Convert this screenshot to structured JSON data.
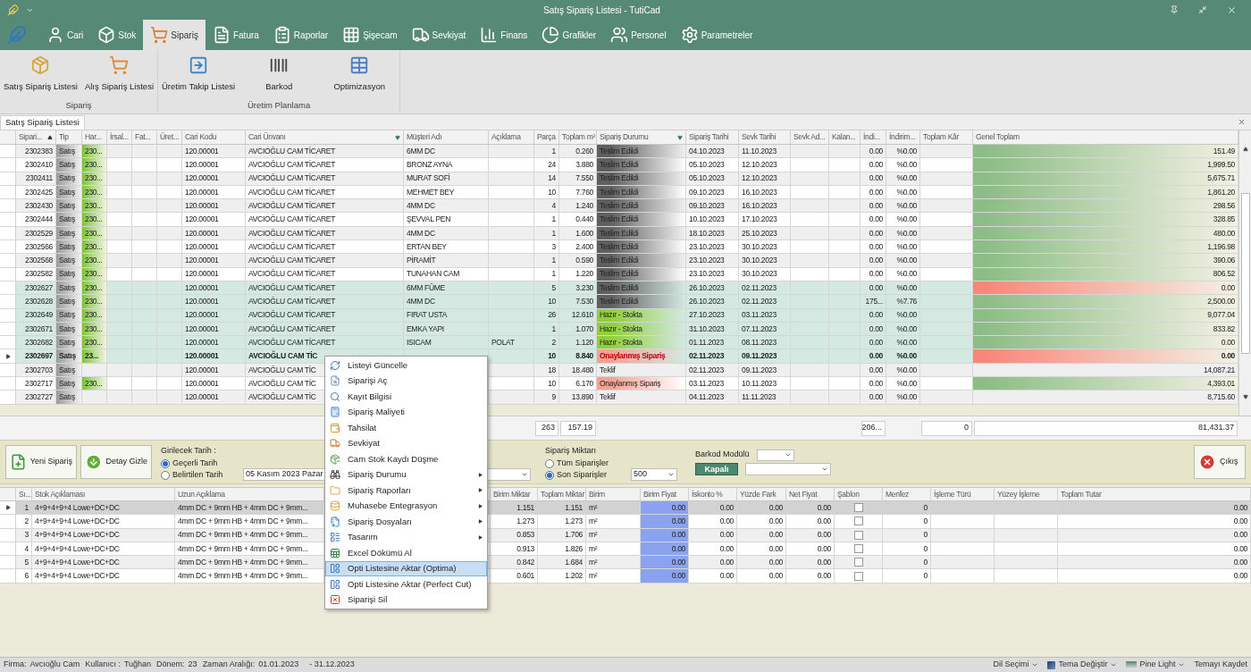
{
  "window": {
    "title": "Satış Sipariş Listesi - TutiCad"
  },
  "ribbon_tabs": [
    {
      "label": "Cari",
      "selected": false
    },
    {
      "label": "Stok",
      "selected": false
    },
    {
      "label": "Sipariş",
      "selected": true
    },
    {
      "label": "Fatura",
      "selected": false
    },
    {
      "label": "Raporlar",
      "selected": false
    },
    {
      "label": "Şişecam",
      "selected": false
    },
    {
      "label": "Sevkiyat",
      "selected": false
    },
    {
      "label": "Finans",
      "selected": false
    },
    {
      "label": "Grafikler",
      "selected": false
    },
    {
      "label": "Personel",
      "selected": false
    },
    {
      "label": "Parametreler",
      "selected": false
    }
  ],
  "ribbon_groups": [
    {
      "title": "Sipariş",
      "buttons": [
        "Satış Sipariş Listesi",
        "Alış Sipariş Listesi"
      ]
    },
    {
      "title": "Üretim Planlama",
      "buttons": [
        "Üretim Takip Listesi",
        "Barkod",
        "Optimizasyon"
      ]
    }
  ],
  "document_tab": {
    "label": "Satış Sipariş Listesi"
  },
  "orders_grid": {
    "columns": [
      {
        "label": "Sipari...",
        "sorted": true
      },
      {
        "label": "Tip"
      },
      {
        "label": "Har..."
      },
      {
        "label": "İrsal..."
      },
      {
        "label": "Fat..."
      },
      {
        "label": "Üret..."
      },
      {
        "label": "Cari Kodu"
      },
      {
        "label": "Cari Ünvanı",
        "filtered": true
      },
      {
        "label": "Müşteri Adı"
      },
      {
        "label": "Açıklama"
      },
      {
        "label": "Parça"
      },
      {
        "label": "Toplam m²"
      },
      {
        "label": "Sipariş Durumu",
        "filtered": true
      },
      {
        "label": "Sipariş Tarihi"
      },
      {
        "label": "Sevk Tarihi"
      },
      {
        "label": "Sevk Ad..."
      },
      {
        "label": "Kalan..."
      },
      {
        "label": "İndi..."
      },
      {
        "label": "İndirim..."
      },
      {
        "label": "Toplam Kâr"
      },
      {
        "label": "Genel Toplam"
      }
    ],
    "rows": [
      {
        "no": "2302383",
        "tip": "Satış",
        "har": "230...",
        "cari_kodu": "120.00001",
        "cari_unvani": "AVCIOĞLU CAM TİCARET",
        "musteri": "6MM DC",
        "parca": "1",
        "m2": "0.260",
        "durum": {
          "text": "Teslim Edildi",
          "color": "#5f5f5f"
        },
        "siparis_tarihi": "04.10.2023",
        "sevk_tarihi": "11.10.2023",
        "indirim_tutar": "0.00",
        "indirim_oran": "%0.00",
        "genel_toplam": {
          "text": "151.49",
          "color": "#8dbd86"
        },
        "highlighted": false,
        "selected": false
      },
      {
        "no": "2302410",
        "tip": "Satış",
        "har": "230...",
        "cari_kodu": "120.00001",
        "cari_unvani": "AVCIOĞLU CAM TİCARET",
        "musteri": "BRONZ AYNA",
        "parca": "24",
        "m2": "3.880",
        "durum": {
          "text": "Teslim Edildi",
          "color": "#5f5f5f"
        },
        "siparis_tarihi": "05.10.2023",
        "sevk_tarihi": "12.10.2023",
        "indirim_tutar": "0.00",
        "indirim_oran": "%0.00",
        "genel_toplam": {
          "text": "1,999.50",
          "color": "#8dbd86"
        },
        "highlighted": false,
        "selected": false
      },
      {
        "no": "2302411",
        "tip": "Satış",
        "har": "230...",
        "cari_kodu": "120.00001",
        "cari_unvani": "AVCIOĞLU CAM TİCARET",
        "musteri": "MURAT SOFİ",
        "parca": "14",
        "m2": "7.550",
        "durum": {
          "text": "Teslim Edildi",
          "color": "#5f5f5f"
        },
        "siparis_tarihi": "05.10.2023",
        "sevk_tarihi": "12.10.2023",
        "indirim_tutar": "0.00",
        "indirim_oran": "%0.00",
        "genel_toplam": {
          "text": "5,675.71",
          "color": "#8dbd86"
        },
        "highlighted": false,
        "selected": false
      },
      {
        "no": "2302425",
        "tip": "Satış",
        "har": "230...",
        "cari_kodu": "120.00001",
        "cari_unvani": "AVCIOĞLU CAM TİCARET",
        "musteri": "MEHMET BEY",
        "parca": "10",
        "m2": "7.760",
        "durum": {
          "text": "Teslim Edildi",
          "color": "#5f5f5f"
        },
        "siparis_tarihi": "09.10.2023",
        "sevk_tarihi": "16.10.2023",
        "indirim_tutar": "0.00",
        "indirim_oran": "%0.00",
        "genel_toplam": {
          "text": "1,861.20",
          "color": "#8dbd86"
        },
        "highlighted": false,
        "selected": false
      },
      {
        "no": "2302430",
        "tip": "Satış",
        "har": "230...",
        "cari_kodu": "120.00001",
        "cari_unvani": "AVCIOĞLU CAM TİCARET",
        "musteri": "4MM DC",
        "parca": "4",
        "m2": "1.240",
        "durum": {
          "text": "Teslim Edildi",
          "color": "#5f5f5f"
        },
        "siparis_tarihi": "09.10.2023",
        "sevk_tarihi": "16.10.2023",
        "indirim_tutar": "0.00",
        "indirim_oran": "%0.00",
        "genel_toplam": {
          "text": "298.56",
          "color": "#8dbd86"
        },
        "highlighted": false,
        "selected": false
      },
      {
        "no": "2302444",
        "tip": "Satış",
        "har": "230...",
        "cari_kodu": "120.00001",
        "cari_unvani": "AVCIOĞLU CAM TİCARET",
        "musteri": "ŞEVVAL PEN",
        "parca": "1",
        "m2": "0.440",
        "durum": {
          "text": "Teslim Edildi",
          "color": "#5f5f5f"
        },
        "siparis_tarihi": "10.10.2023",
        "sevk_tarihi": "17.10.2023",
        "indirim_tutar": "0.00",
        "indirim_oran": "%0.00",
        "genel_toplam": {
          "text": "328.85",
          "color": "#8dbd86"
        },
        "highlighted": false,
        "selected": false
      },
      {
        "no": "2302529",
        "tip": "Satış",
        "har": "230...",
        "cari_kodu": "120.00001",
        "cari_unvani": "AVCIOĞLU CAM TİCARET",
        "musteri": "4MM DC",
        "parca": "1",
        "m2": "1.600",
        "durum": {
          "text": "Teslim Edildi",
          "color": "#5f5f5f"
        },
        "siparis_tarihi": "18.10.2023",
        "sevk_tarihi": "25.10.2023",
        "indirim_tutar": "0.00",
        "indirim_oran": "%0.00",
        "genel_toplam": {
          "text": "480.00",
          "color": "#8dbd86"
        },
        "highlighted": false,
        "selected": false
      },
      {
        "no": "2302566",
        "tip": "Satış",
        "har": "230...",
        "cari_kodu": "120.00001",
        "cari_unvani": "AVCIOĞLU CAM TİCARET",
        "musteri": "ERTAN  BEY",
        "parca": "3",
        "m2": "2.400",
        "durum": {
          "text": "Teslim Edildi",
          "color": "#5f5f5f"
        },
        "siparis_tarihi": "23.10.2023",
        "sevk_tarihi": "30.10.2023",
        "indirim_tutar": "0.00",
        "indirim_oran": "%0.00",
        "genel_toplam": {
          "text": "1,196.98",
          "color": "#8dbd86"
        },
        "highlighted": false,
        "selected": false
      },
      {
        "no": "2302568",
        "tip": "Satış",
        "har": "230...",
        "cari_kodu": "120.00001",
        "cari_unvani": "AVCIOĞLU CAM TİCARET",
        "musteri": "PİRAMİT",
        "parca": "1",
        "m2": "0.590",
        "durum": {
          "text": "Teslim Edildi",
          "color": "#5f5f5f"
        },
        "siparis_tarihi": "23.10.2023",
        "sevk_tarihi": "30.10.2023",
        "indirim_tutar": "0.00",
        "indirim_oran": "%0.00",
        "genel_toplam": {
          "text": "390.06",
          "color": "#8dbd86"
        },
        "highlighted": false,
        "selected": false
      },
      {
        "no": "2302582",
        "tip": "Satış",
        "har": "230...",
        "cari_kodu": "120.00001",
        "cari_unvani": "AVCIOĞLU CAM TİCARET",
        "musteri": "TUNAHAN CAM",
        "parca": "1",
        "m2": "1.220",
        "durum": {
          "text": "Teslim Edildi",
          "color": "#5f5f5f"
        },
        "siparis_tarihi": "23.10.2023",
        "sevk_tarihi": "30.10.2023",
        "indirim_tutar": "0.00",
        "indirim_oran": "%0.00",
        "genel_toplam": {
          "text": "806.52",
          "color": "#8dbd86"
        },
        "highlighted": false,
        "selected": false
      },
      {
        "no": "2302627",
        "tip": "Satış",
        "har": "230...",
        "cari_kodu": "120.00001",
        "cari_unvani": "AVCIOĞLU CAM TİCARET",
        "musteri": "6MM FÜME",
        "parca": "5",
        "m2": "3.230",
        "durum": {
          "text": "Teslim Edildi",
          "color": "#5f5f5f"
        },
        "siparis_tarihi": "26.10.2023",
        "sevk_tarihi": "02.11.2023",
        "indirim_tutar": "0.00",
        "indirim_oran": "%0.00",
        "genel_toplam": {
          "text": "0.00",
          "color": "#f8877a"
        },
        "highlighted": true,
        "selected": false
      },
      {
        "no": "2302628",
        "tip": "Satış",
        "har": "230...",
        "cari_kodu": "120.00001",
        "cari_unvani": "AVCIOĞLU CAM TİCARET",
        "musteri": "4MM DC",
        "parca": "10",
        "m2": "7.530",
        "durum": {
          "text": "Teslim Edildi",
          "color": "#5f5f5f"
        },
        "siparis_tarihi": "26.10.2023",
        "sevk_tarihi": "02.11.2023",
        "indirim_tutar": "175...",
        "indirim_oran": "%7.76",
        "genel_toplam": {
          "text": "2,500.00",
          "color": "#8dbd86"
        },
        "highlighted": true,
        "selected": false
      },
      {
        "no": "2302649",
        "tip": "Satış",
        "har": "230...",
        "cari_kodu": "120.00001",
        "cari_unvani": "AVCIOĞLU CAM TİCARET",
        "musteri": "FIRAT USTA",
        "parca": "26",
        "m2": "12.610",
        "durum": {
          "text": "Hazır - Stokta",
          "color": "#8fcf3a"
        },
        "siparis_tarihi": "27.10.2023",
        "sevk_tarihi": "03.11.2023",
        "indirim_tutar": "0.00",
        "indirim_oran": "%0.00",
        "genel_toplam": {
          "text": "9,077.04",
          "color": "#8dbd86"
        },
        "highlighted": true,
        "selected": false
      },
      {
        "no": "2302671",
        "tip": "Satış",
        "har": "230...",
        "cari_kodu": "120.00001",
        "cari_unvani": "AVCIOĞLU CAM TİCARET",
        "musteri": "EMKA YAPI",
        "parca": "1",
        "m2": "1.070",
        "durum": {
          "text": "Hazır - Stokta",
          "color": "#8fcf3a"
        },
        "siparis_tarihi": "31.10.2023",
        "sevk_tarihi": "07.11.2023",
        "indirim_tutar": "0.00",
        "indirim_oran": "%0.00",
        "genel_toplam": {
          "text": "833.82",
          "color": "#8dbd86"
        },
        "highlighted": true,
        "selected": false
      },
      {
        "no": "2302682",
        "tip": "Satış",
        "har": "230...",
        "cari_kodu": "120.00001",
        "cari_unvani": "AVCIOĞLU CAM TİCARET",
        "musteri": "ISICAM",
        "aciklama": "POLAT",
        "parca": "2",
        "m2": "1.120",
        "durum": {
          "text": "Hazır - Stokta",
          "color": "#8fcf3a"
        },
        "siparis_tarihi": "01.11.2023",
        "sevk_tarihi": "08.11.2023",
        "indirim_tutar": "0.00",
        "indirim_oran": "%0.00",
        "genel_toplam": {
          "text": "0.00",
          "color": "#8dbd86"
        },
        "highlighted": true,
        "selected": false
      },
      {
        "no": "2302697",
        "tip": "Satış",
        "har": "23...",
        "cari_kodu": "120.00001",
        "cari_unvani": "AVCIOĞLU CAM TİC",
        "parca": "10",
        "m2": "8.840",
        "durum": {
          "text": "Onaylanmış Sipariş",
          "color": "#f7a193"
        },
        "siparis_tarihi": "02.11.2023",
        "sevk_tarihi": "09.11.2023",
        "indirim_tutar": "0.00",
        "indirim_oran": "%0.00",
        "genel_toplam": {
          "text": "0.00",
          "color": "#f8877a"
        },
        "highlighted": true,
        "selected": true
      },
      {
        "no": "2302703",
        "tip": "Satış",
        "cari_kodu": "120.00001",
        "cari_unvani": "AVCIOĞLU CAM TİC",
        "parca": "18",
        "m2": "18.480",
        "durum": {
          "text": "Teklif"
        },
        "siparis_tarihi": "02.11.2023",
        "sevk_tarihi": "09.11.2023",
        "indirim_tutar": "0.00",
        "indirim_oran": "%0.00",
        "genel_toplam": {
          "text": "14,087.21"
        },
        "highlighted": false,
        "selected": false
      },
      {
        "no": "2302717",
        "tip": "Satış",
        "har": "230...",
        "cari_kodu": "120.00001",
        "cari_unvani": "AVCIOĞLU CAM TİC",
        "parca": "10",
        "m2": "6.170",
        "durum": {
          "text": "Onaylanmış Sipariş",
          "color": "#f7a193"
        },
        "siparis_tarihi": "03.11.2023",
        "sevk_tarihi": "10.11.2023",
        "indirim_tutar": "0.00",
        "indirim_oran": "%0.00",
        "genel_toplam": {
          "text": "4,393.01",
          "color": "#8dbd86"
        },
        "highlighted": false,
        "selected": false
      },
      {
        "no": "2302727",
        "tip": "Satış",
        "cari_kodu": "120.00001",
        "cari_unvani": "AVCIOĞLU CAM TİC",
        "parca": "9",
        "m2": "13.890",
        "durum": {
          "text": "Teklif"
        },
        "siparis_tarihi": "04.11.2023",
        "sevk_tarihi": "11.11.2023",
        "indirim_tutar": "0.00",
        "indirim_oran": "%0.00",
        "genel_toplam": {
          "text": "8,715.60"
        },
        "highlighted": false,
        "selected": false
      }
    ],
    "totals": {
      "parca": "263",
      "m2": "157.19",
      "indirim_tutar": "206...",
      "toplam_kar": "0",
      "genel_toplam": "81,431.37"
    }
  },
  "controls": {
    "new_order": "Yeni Sipariş",
    "hide_detail": "Detay Gizle",
    "date_group": {
      "title": "Girilecek Tarih :",
      "options": [
        {
          "label": "Geçerli Tarih",
          "selected": true
        },
        {
          "label": "Belirtilen Tarih",
          "selected": false
        }
      ],
      "date": "05 Kasım 2023 Pazar"
    },
    "quantity_group": {
      "title": "Sipariş Miktarı",
      "options": [
        {
          "label": "Tüm Siparişler",
          "selected": false
        },
        {
          "label": "Son Siparişler",
          "selected": true
        }
      ],
      "count": "500"
    },
    "barcode_group": {
      "title": "Barkod Modülü",
      "toggle": "Kapalı"
    },
    "exit": "Çıkış"
  },
  "detail_grid": {
    "columns": [
      "Sı...",
      "Stok Açıklaması",
      "Uzun Açıklama",
      "Birim Miktar",
      "Toplam Miktar",
      "Birim",
      "Birim Fiyat",
      "İskonto %",
      "Yüzde Fark",
      "Net Fiyat",
      "Şablon",
      "Menfez",
      "İşleme Türü",
      "Yüzey İşleme",
      "Toplam Tutar"
    ],
    "rows": [
      {
        "sira": "1",
        "stok": "4+9+4+9+4 Lowe+DC+DC",
        "uzun": "4mm DC + 9mm HB + 4mm DC + 9mm...",
        "birim_miktar": "1.151",
        "toplam_miktar": "1.151",
        "birim": "m²",
        "birim_fiyat": "0.00",
        "iskonto": "0.00",
        "yuzde_fark": "0.00",
        "net_fiyat": "0.00",
        "sablon": false,
        "menfez": "0",
        "toplam_tutar": "0.00",
        "selected": true
      },
      {
        "sira": "2",
        "stok": "4+9+4+9+4 Lowe+DC+DC",
        "uzun": "4mm DC + 9mm HB + 4mm DC + 9mm...",
        "birim_miktar": "1.273",
        "toplam_miktar": "1.273",
        "birim": "m²",
        "birim_fiyat": "0.00",
        "iskonto": "0.00",
        "yuzde_fark": "0.00",
        "net_fiyat": "0.00",
        "sablon": false,
        "menfez": "0",
        "toplam_tutar": "0.00",
        "selected": false
      },
      {
        "sira": "3",
        "stok": "4+9+4+9+4 Lowe+DC+DC",
        "uzun": "4mm DC + 9mm HB + 4mm DC + 9mm...",
        "birim_miktar": "0.853",
        "toplam_miktar": "1.706",
        "birim": "m²",
        "birim_fiyat": "0.00",
        "iskonto": "0.00",
        "yuzde_fark": "0.00",
        "net_fiyat": "0.00",
        "sablon": false,
        "menfez": "0",
        "toplam_tutar": "0.00",
        "selected": false
      },
      {
        "sira": "4",
        "stok": "4+9+4+9+4 Lowe+DC+DC",
        "uzun": "4mm DC + 9mm HB + 4mm DC + 9mm...",
        "birim_miktar": "0.913",
        "toplam_miktar": "1.826",
        "birim": "m²",
        "birim_fiyat": "0.00",
        "iskonto": "0.00",
        "yuzde_fark": "0.00",
        "net_fiyat": "0.00",
        "sablon": false,
        "menfez": "0",
        "toplam_tutar": "0.00",
        "selected": false
      },
      {
        "sira": "5",
        "stok": "4+9+4+9+4 Lowe+DC+DC",
        "uzun": "4mm DC + 9mm HB + 4mm DC + 9mm...",
        "birim_miktar": "0.842",
        "toplam_miktar": "1.684",
        "birim": "m²",
        "birim_fiyat": "0.00",
        "iskonto": "0.00",
        "yuzde_fark": "0.00",
        "net_fiyat": "0.00",
        "sablon": false,
        "menfez": "0",
        "toplam_tutar": "0.00",
        "selected": false
      },
      {
        "sira": "6",
        "stok": "4+9+4+9+4 Lowe+DC+DC",
        "uzun": "4mm DC + 9mm HB + 4mm DC + 9mm...",
        "birim_miktar": "0.601",
        "toplam_miktar": "1.202",
        "birim": "m²",
        "birim_fiyat": "0.00",
        "iskonto": "0.00",
        "yuzde_fark": "0.00",
        "net_fiyat": "0.00",
        "sablon": false,
        "menfez": "0",
        "toplam_tutar": "0.00",
        "selected": false
      }
    ]
  },
  "context_menu": {
    "items": [
      {
        "label": "Listeyi Güncelle",
        "submenu": false,
        "selected": false
      },
      {
        "label": "Siparişi Aç",
        "submenu": false,
        "selected": false
      },
      {
        "label": "Kayıt Bilgisi",
        "submenu": false,
        "selected": false
      },
      {
        "label": "Sipariş Maliyeti",
        "submenu": false,
        "selected": false
      },
      {
        "label": "Tahsilat",
        "submenu": false,
        "selected": false
      },
      {
        "label": "Sevkiyat",
        "submenu": false,
        "selected": false
      },
      {
        "label": "Cam Stok Kaydı Düşme",
        "submenu": false,
        "selected": false
      },
      {
        "label": "Sipariş Durumu",
        "submenu": true,
        "selected": false
      },
      {
        "label": "Sipariş Raporları",
        "submenu": true,
        "selected": false
      },
      {
        "label": "Muhasebe Entegrasyon",
        "submenu": true,
        "selected": false
      },
      {
        "label": "Sipariş Dosyaları",
        "submenu": true,
        "selected": false
      },
      {
        "label": "Tasarım",
        "submenu": true,
        "selected": false
      },
      {
        "label": "Excel Dökümü Al",
        "submenu": false,
        "selected": false
      },
      {
        "label": "Opti Listesine Aktar (Optima)",
        "submenu": false,
        "selected": true
      },
      {
        "label": "Opti Listesine Aktar (Perfect Cut)",
        "submenu": false,
        "selected": false
      },
      {
        "label": "Siparişi Sil",
        "submenu": false,
        "selected": false
      }
    ]
  },
  "status_bar": {
    "fields": [
      {
        "label": "Firma:",
        "value": "Avcıoğlu Cam"
      },
      {
        "label": "Kullanıcı :",
        "value": "Tuğhan"
      },
      {
        "label": "Dönem:",
        "value": "23"
      },
      {
        "label": "Zaman Aralığı:",
        "value": "01.01.2023"
      }
    ],
    "range_end": "- 31.12.2023",
    "menus": [
      {
        "label": "Dil Seçimi",
        "kind": "plain",
        "dropdown": true
      },
      {
        "label": "Tema Değiştir",
        "kind": "theme",
        "dropdown": true
      },
      {
        "label": "Pine Light",
        "kind": "swatch",
        "dropdown": true
      },
      {
        "label": "Temayı Kaydet",
        "kind": "plain",
        "dropdown": false
      }
    ]
  }
}
